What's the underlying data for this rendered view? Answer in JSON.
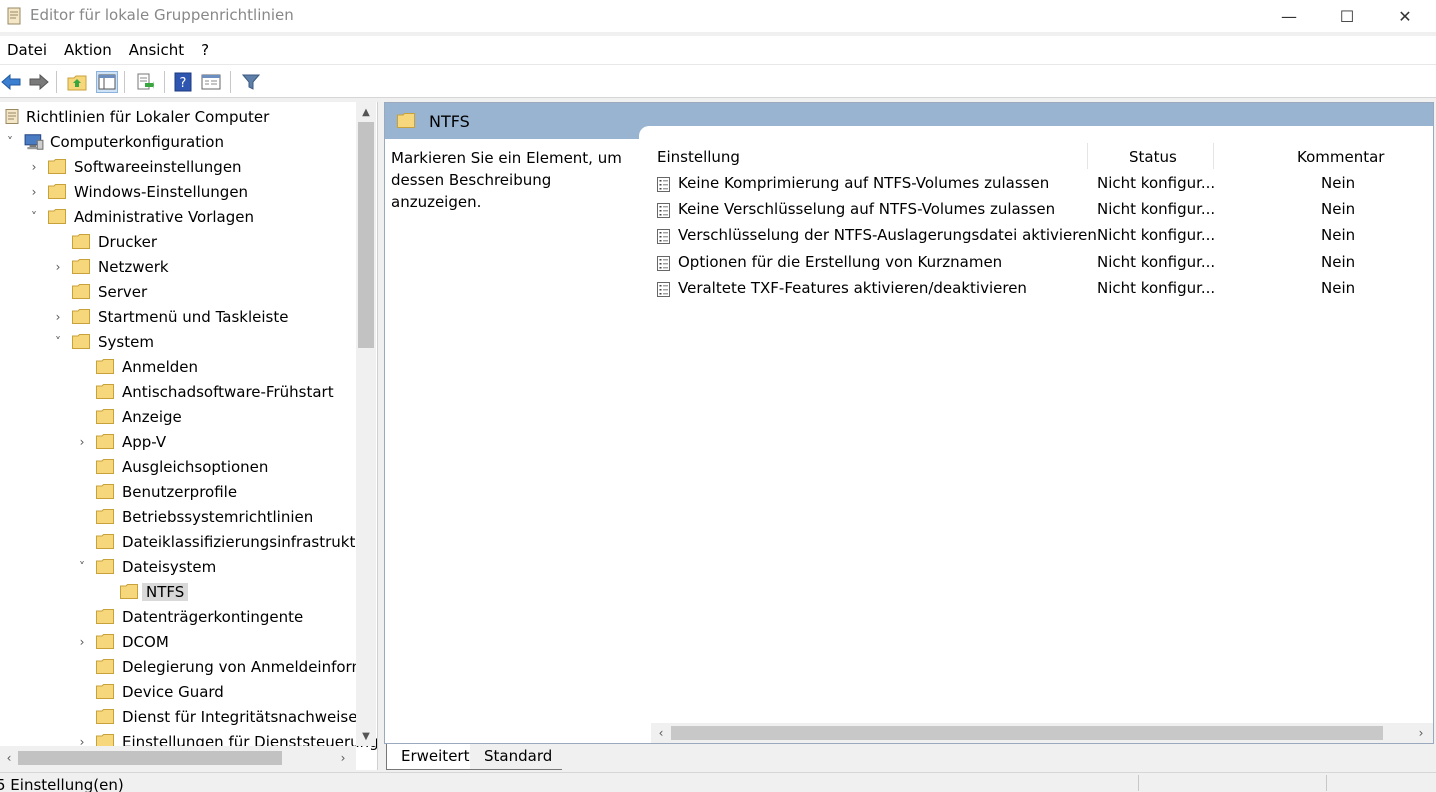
{
  "window": {
    "title": "Editor für lokale Gruppenrichtlinien",
    "minimize_icon": "minimize-icon",
    "maximize_icon": "maximize-icon",
    "close_icon": "close-icon"
  },
  "menu": [
    {
      "label": "Datei"
    },
    {
      "label": "Aktion"
    },
    {
      "label": "Ansicht"
    },
    {
      "label": "?"
    }
  ],
  "toolbar": [
    {
      "icon": "back-arrow-icon"
    },
    {
      "icon": "forward-arrow-icon"
    },
    {
      "icon": "up-folder-icon"
    },
    {
      "icon": "show-hide-tree-icon"
    },
    {
      "icon": "export-list-icon"
    },
    {
      "icon": "help-icon"
    },
    {
      "icon": "properties-view-icon"
    },
    {
      "icon": "filter-icon"
    }
  ],
  "tree": [
    {
      "label": "Richtlinien für Lokaler Computer",
      "level": 0,
      "icon": "policy-document-icon",
      "expander": ""
    },
    {
      "label": "Computerkonfiguration",
      "level": 0,
      "icon": "computer-icon",
      "expander": "˅"
    },
    {
      "label": "Softwareeinstellungen",
      "level": 1,
      "icon": "folder-icon",
      "expander": "›"
    },
    {
      "label": "Windows-Einstellungen",
      "level": 1,
      "icon": "folder-icon",
      "expander": "›"
    },
    {
      "label": "Administrative Vorlagen",
      "level": 1,
      "icon": "folder-icon",
      "expander": "˅"
    },
    {
      "label": "Drucker",
      "level": 2,
      "icon": "folder-icon",
      "expander": ""
    },
    {
      "label": "Netzwerk",
      "level": 2,
      "icon": "folder-icon",
      "expander": "›"
    },
    {
      "label": "Server",
      "level": 2,
      "icon": "folder-icon",
      "expander": ""
    },
    {
      "label": "Startmenü und Taskleiste",
      "level": 2,
      "icon": "folder-icon",
      "expander": "›"
    },
    {
      "label": "System",
      "level": 2,
      "icon": "folder-icon",
      "expander": "˅"
    },
    {
      "label": "Anmelden",
      "level": 3,
      "icon": "folder-icon",
      "expander": ""
    },
    {
      "label": "Antischadsoftware-Frühstart",
      "level": 3,
      "icon": "folder-icon",
      "expander": ""
    },
    {
      "label": "Anzeige",
      "level": 3,
      "icon": "folder-icon",
      "expander": ""
    },
    {
      "label": "App-V",
      "level": 3,
      "icon": "folder-icon",
      "expander": "›"
    },
    {
      "label": "Ausgleichsoptionen",
      "level": 3,
      "icon": "folder-icon",
      "expander": ""
    },
    {
      "label": "Benutzerprofile",
      "level": 3,
      "icon": "folder-icon",
      "expander": ""
    },
    {
      "label": "Betriebssystemrichtlinien",
      "level": 3,
      "icon": "folder-icon",
      "expander": ""
    },
    {
      "label": "Dateiklassifizierungsinfrastruktur",
      "level": 3,
      "icon": "folder-icon",
      "expander": ""
    },
    {
      "label": "Dateisystem",
      "level": 3,
      "icon": "folder-icon",
      "expander": "˅"
    },
    {
      "label": "NTFS",
      "level": 4,
      "icon": "folder-icon",
      "expander": "",
      "selected": true
    },
    {
      "label": "Datenträgerkontingente",
      "level": 3,
      "icon": "folder-icon",
      "expander": ""
    },
    {
      "label": "DCOM",
      "level": 3,
      "icon": "folder-icon",
      "expander": "›"
    },
    {
      "label": "Delegierung von Anmeldeinforma",
      "level": 3,
      "icon": "folder-icon",
      "expander": ""
    },
    {
      "label": "Device Guard",
      "level": 3,
      "icon": "folder-icon",
      "expander": ""
    },
    {
      "label": "Dienst für Integritätsnachweise für",
      "level": 3,
      "icon": "folder-icon",
      "expander": ""
    },
    {
      "label": "Einstellungen für Dienststeuerungs",
      "level": 3,
      "icon": "folder-icon",
      "expander": "›"
    }
  ],
  "right_pane": {
    "header": "NTFS",
    "description": "Markieren Sie ein Element, um dessen Beschreibung anzuzeigen.",
    "columns": [
      "Einstellung",
      "Status",
      "Kommentar"
    ],
    "rows": [
      {
        "name": "Keine Komprimierung auf NTFS-Volumes zulassen",
        "status": "Nicht konfigur...",
        "comment": "Nein"
      },
      {
        "name": "Keine Verschlüsselung auf NTFS-Volumes zulassen",
        "status": "Nicht konfigur...",
        "comment": "Nein"
      },
      {
        "name": "Verschlüsselung der NTFS-Auslagerungsdatei aktivieren",
        "status": "Nicht konfigur...",
        "comment": "Nein"
      },
      {
        "name": "Optionen für die Erstellung von Kurznamen",
        "status": "Nicht konfigur...",
        "comment": "Nein"
      },
      {
        "name": "Veraltete TXF-Features aktivieren/deaktivieren",
        "status": "Nicht konfigur...",
        "comment": "Nein"
      }
    ]
  },
  "tabs": [
    "Erweitert",
    "Standard"
  ],
  "statusbar": "5 Einstellung(en)",
  "colors": {
    "header_blue": "#99b4d1",
    "folder_yellow": "#f6d77b",
    "selection": "#d9d9d9"
  }
}
